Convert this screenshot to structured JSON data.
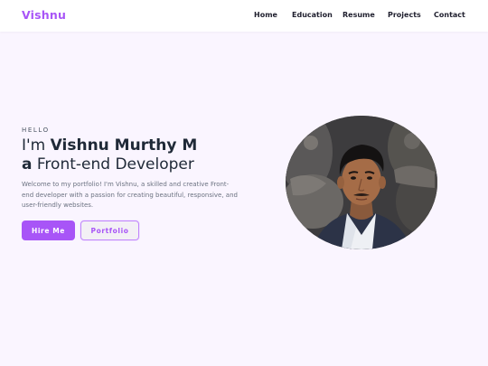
{
  "brand": {
    "logo_text": "Vishnu",
    "accent": "#a855f7"
  },
  "nav": {
    "items": [
      "Home",
      "Education",
      "Resume",
      "Projects",
      "Contact"
    ]
  },
  "hero": {
    "eyebrow": "HELLO",
    "title_prefix": "I'm ",
    "name": "Vishnu Murthy M",
    "role_article": "a",
    "role": " Front-end Developer",
    "description": "Welcome to my portfolio! I'm Vishnu, a skilled and creative Front-end developer with a passion for creating beautiful, responsive, and user-friendly websites.",
    "primary_button": "Hire Me",
    "secondary_button": "Portfolio",
    "photo_icon": "profile-photo"
  },
  "colors": {
    "page_bg": "#faf5ff",
    "navbar_bg": "#ffffff",
    "text_dark": "#1f2937",
    "text_muted": "#6b7280"
  }
}
